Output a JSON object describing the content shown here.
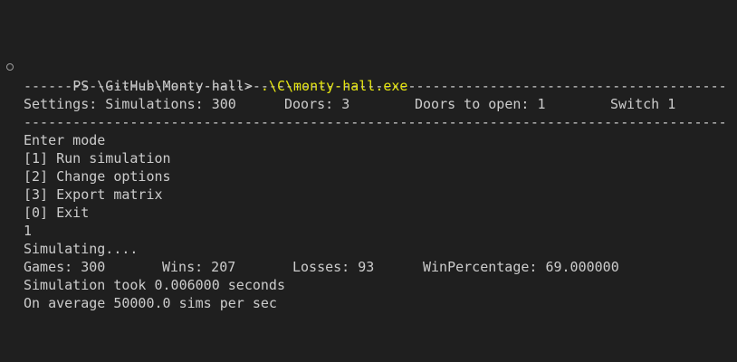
{
  "prompt": {
    "text": "PS \\GitHub\\Monty-hall> ",
    "command": ".\\C\\monty-hall.exe"
  },
  "divider": "--------------------------------------------------------------------------------------------------------------------",
  "settings": {
    "simulations": "Settings: Simulations: 300",
    "doors": "Doors: 3",
    "doors_to_open": "Doors to open: 1",
    "switch": "Switch 1"
  },
  "menu": {
    "title": "Enter mode",
    "items": [
      "[1] Run simulation",
      "[2] Change options",
      "[3] Export matrix",
      "[0] Exit"
    ]
  },
  "input_value": "1",
  "simulating": "Simulating....",
  "results": {
    "games": "Games: 300",
    "wins": "Wins: 207",
    "losses": "Losses: 93",
    "win_percentage": "WinPercentage: 69.000000"
  },
  "timing": "Simulation took 0.006000 seconds",
  "average": "On average 50000.0 sims per sec"
}
